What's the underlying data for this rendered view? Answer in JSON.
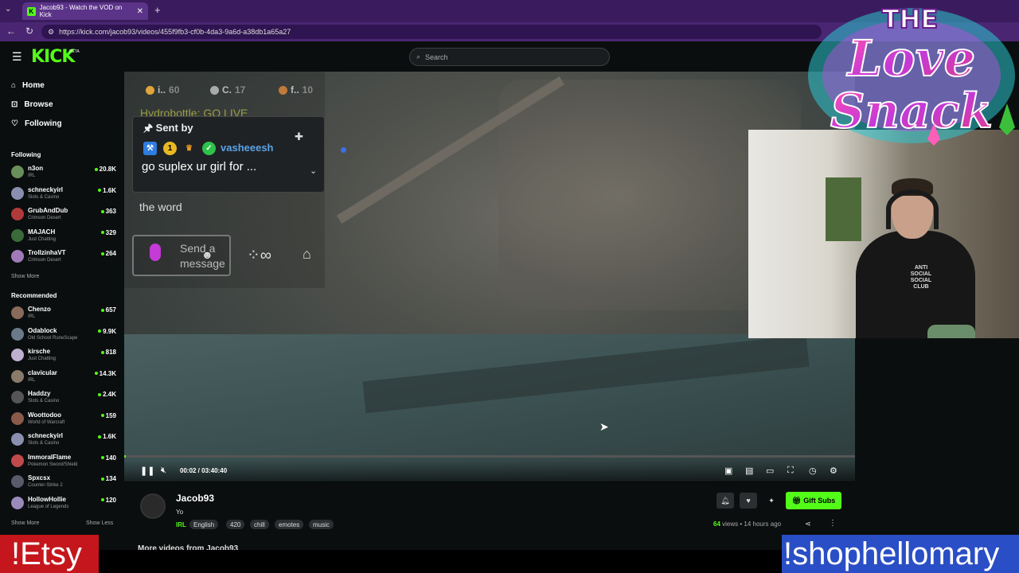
{
  "browser": {
    "tab_title": "Jacob93 - Watch the VOD on Kick",
    "tab_favicon": "K",
    "url": "https://kick.com/jacob93/videos/455f9fb3-cf0b-4da3-9a6d-a38db1a65a27"
  },
  "header": {
    "logo": "KICK",
    "logo_badge": "BETA",
    "search_placeholder": "Search"
  },
  "sidebar": {
    "nav": [
      {
        "icon": "home-icon",
        "label": "Home"
      },
      {
        "icon": "browse-icon",
        "label": "Browse"
      },
      {
        "icon": "heart-icon",
        "label": "Following"
      }
    ],
    "following_title": "Following",
    "following": [
      {
        "name": "n3on",
        "category": "IRL",
        "viewers": "20.8K",
        "color": "#6a8f5a"
      },
      {
        "name": "schneckyirl",
        "category": "Slots & Casino",
        "viewers": "1.6K",
        "color": "#8a8fb0"
      },
      {
        "name": "GrubAndDub",
        "category": "Crimson Desert",
        "viewers": "363",
        "color": "#b03a3a"
      },
      {
        "name": "MAJACH",
        "category": "Just Chatting",
        "viewers": "329",
        "color": "#3a6a3a"
      },
      {
        "name": "TrollzinhaVT",
        "category": "Crimson Desert",
        "viewers": "264",
        "color": "#a07ab8"
      }
    ],
    "show_more_1": "Show More",
    "recommended_title": "Recommended",
    "recommended": [
      {
        "name": "Chenzo",
        "category": "IRL",
        "viewers": "657",
        "color": "#8a6a5a"
      },
      {
        "name": "Odablock",
        "category": "Old School RuneScape",
        "viewers": "9.9K",
        "color": "#6a7a8a"
      },
      {
        "name": "kirsche",
        "category": "Just Chatting",
        "viewers": "818",
        "color": "#c0b0d0"
      },
      {
        "name": "clavicular",
        "category": "IRL",
        "viewers": "14.3K",
        "color": "#8a7a6a"
      },
      {
        "name": "Haddzy",
        "category": "Slots & Casino",
        "viewers": "2.4K",
        "color": "#555555"
      },
      {
        "name": "Woottodoo",
        "category": "World of Warcraft",
        "viewers": "159",
        "color": "#8a5a4a"
      },
      {
        "name": "schneckyirl",
        "category": "Slots & Casino",
        "viewers": "1.6K",
        "color": "#8a8fb0"
      },
      {
        "name": "ImmoralFlame",
        "category": "Pokemon Sword/Shield",
        "viewers": "140",
        "color": "#c04a4a"
      },
      {
        "name": "Spxcsx",
        "category": "Counter-Strike 2",
        "viewers": "134",
        "color": "#5a5a6a"
      },
      {
        "name": "HollowHollie",
        "category": "League of Legends",
        "viewers": "120",
        "color": "#9a8aba"
      }
    ],
    "show_more_2": "Show More",
    "show_less": "Show Less"
  },
  "video_overlay": {
    "leaderboard": [
      {
        "name": "i..",
        "count": "60",
        "color": "#e0a43a"
      },
      {
        "name": "C.",
        "count": "17",
        "color": "#aaaaaa"
      },
      {
        "name": "f..",
        "count": "10",
        "color": "#c07a3a"
      }
    ],
    "ghost_line": "Hydrobottle: GO LIVE",
    "pinned": {
      "sent_by": "Sent by",
      "username": "vasheeesh",
      "message": "go suplex ur girl for ...",
      "badge_sub": "1"
    },
    "chat_line": "the word",
    "send_placeholder": "Send a message",
    "infinity": "∞"
  },
  "player": {
    "time": "00:02 / 03:40:40",
    "progress": 0.0002
  },
  "webcam": {
    "shirt_text": "ANTI SOCIAL SOCIAL CLUB"
  },
  "logo_overlay": {
    "line1": "THE",
    "line2": "Love",
    "line3": "Snack"
  },
  "streamer": {
    "name": "Jacob93",
    "title": "Yo",
    "category": "IRL",
    "tags": [
      "English",
      "420",
      "chill",
      "emotes",
      "music"
    ],
    "views_count": "64",
    "views_label": "views",
    "age": "• 14 hours ago",
    "gift_label": "Gift Subs",
    "more_videos": "More videos from Jacob93"
  },
  "overlays": {
    "etsy": "!Etsy",
    "shop": "!shophellomary"
  }
}
